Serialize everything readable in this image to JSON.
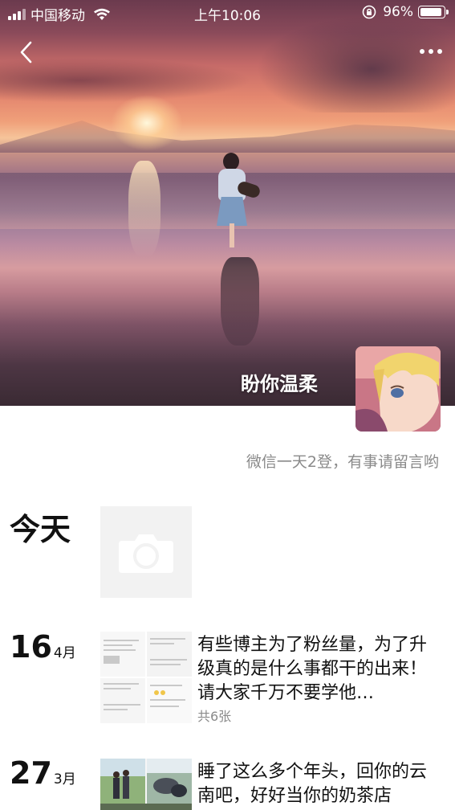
{
  "status_bar": {
    "carrier": "中国移动",
    "time": "上午10:06",
    "battery": "96%",
    "battery_level": 0.96
  },
  "nav": {
    "back_icon": "chevron-left-icon",
    "more_icon": "more-dots-icon"
  },
  "cover": {
    "signature_on_cover": "盼你温柔"
  },
  "profile": {
    "motto": "微信一天2登，有事请留言哟"
  },
  "today": {
    "label": "今天",
    "camera_icon": "camera-icon"
  },
  "posts": [
    {
      "day": "16",
      "month": "4月",
      "text": "有些博主为了粉丝量，为了升级真的是什么事都干的出来！请大家千万不要学他…",
      "count": "共6张"
    },
    {
      "day": "27",
      "month": "3月",
      "text": "睡了这么多个年头，回你的云南吧，好好当你的奶茶店"
    }
  ]
}
